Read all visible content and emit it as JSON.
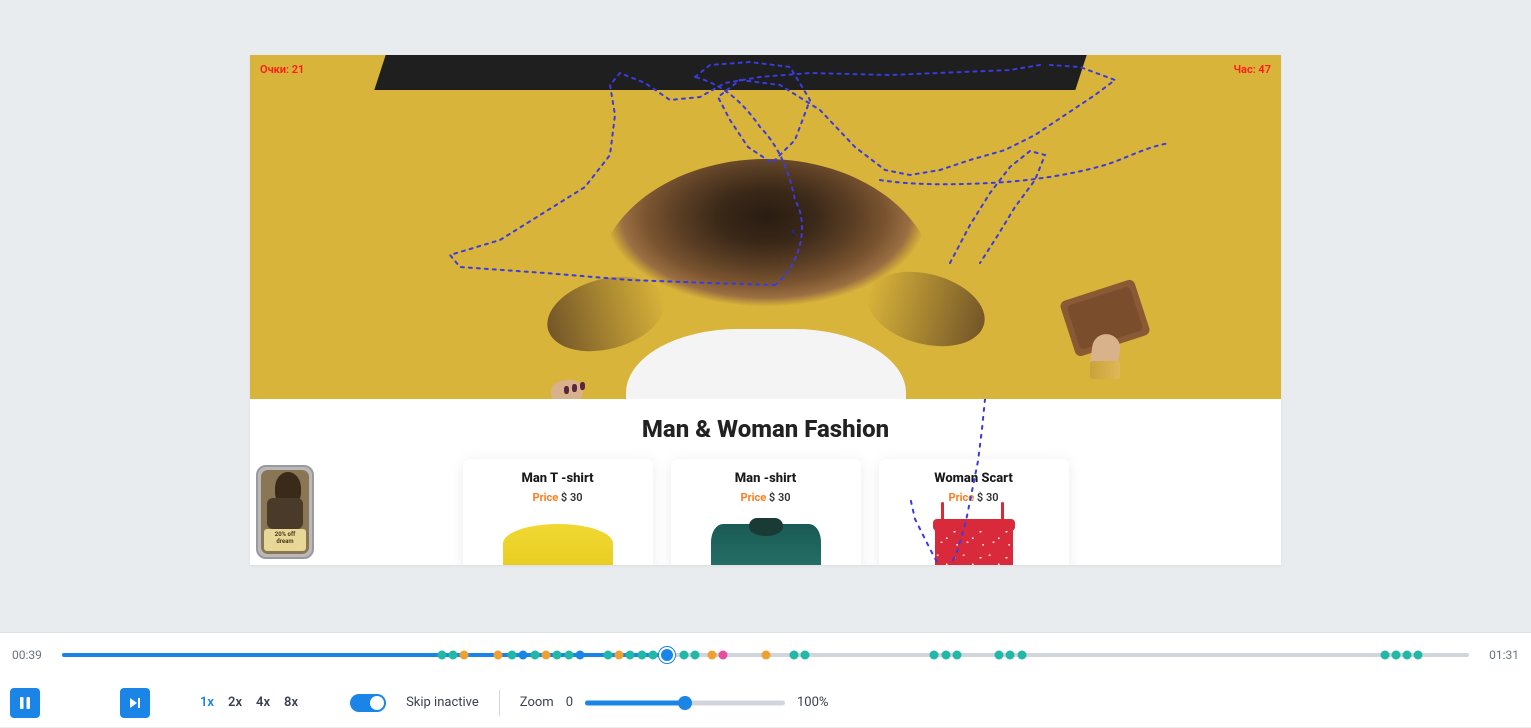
{
  "overlay": {
    "topleft": "Очки: 21",
    "topright": "Час: 47"
  },
  "section_title": "Man & Woman Fashion",
  "products": [
    {
      "title": "Man T -shirt",
      "price_label": "Price",
      "price_value": "$ 30"
    },
    {
      "title": "Man -shirt",
      "price_label": "Price",
      "price_value": "$ 30"
    },
    {
      "title": "Woman Scart",
      "price_label": "Price",
      "price_value": "$ 30"
    }
  ],
  "promo": {
    "line1": "20% off",
    "line2": "dream"
  },
  "player": {
    "current_time": "00:39",
    "total_time": "01:31",
    "progress_pct": 43,
    "speeds": [
      "1x",
      "2x",
      "4x",
      "8x"
    ],
    "active_speed": "1x",
    "skip_label": "Skip inactive",
    "skip_on": true,
    "zoom_label": "Zoom",
    "zoom_min": "0",
    "zoom_max": "100%",
    "zoom_pct": 50
  },
  "events": [
    {
      "pos": 27,
      "type": "teal"
    },
    {
      "pos": 27.8,
      "type": "teal"
    },
    {
      "pos": 28.6,
      "type": "orange"
    },
    {
      "pos": 31,
      "type": "orange"
    },
    {
      "pos": 32,
      "type": "teal"
    },
    {
      "pos": 32.8,
      "type": "blue"
    },
    {
      "pos": 33.6,
      "type": "teal"
    },
    {
      "pos": 34.4,
      "type": "orange"
    },
    {
      "pos": 35.2,
      "type": "teal"
    },
    {
      "pos": 36,
      "type": "teal"
    },
    {
      "pos": 36.8,
      "type": "blue"
    },
    {
      "pos": 38.8,
      "type": "teal"
    },
    {
      "pos": 39.6,
      "type": "orange"
    },
    {
      "pos": 40.4,
      "type": "teal"
    },
    {
      "pos": 41.2,
      "type": "teal"
    },
    {
      "pos": 42,
      "type": "teal"
    },
    {
      "pos": 44.2,
      "type": "teal"
    },
    {
      "pos": 45,
      "type": "teal"
    },
    {
      "pos": 46.2,
      "type": "orange"
    },
    {
      "pos": 47,
      "type": "pink"
    },
    {
      "pos": 50,
      "type": "orange"
    },
    {
      "pos": 52,
      "type": "teal"
    },
    {
      "pos": 52.8,
      "type": "teal"
    },
    {
      "pos": 62,
      "type": "teal"
    },
    {
      "pos": 62.8,
      "type": "teal"
    },
    {
      "pos": 63.6,
      "type": "teal"
    },
    {
      "pos": 66.6,
      "type": "teal"
    },
    {
      "pos": 67.4,
      "type": "teal"
    },
    {
      "pos": 68.2,
      "type": "teal"
    },
    {
      "pos": 94,
      "type": "teal"
    },
    {
      "pos": 94.8,
      "type": "teal"
    },
    {
      "pos": 95.6,
      "type": "teal"
    },
    {
      "pos": 96.4,
      "type": "teal"
    }
  ]
}
